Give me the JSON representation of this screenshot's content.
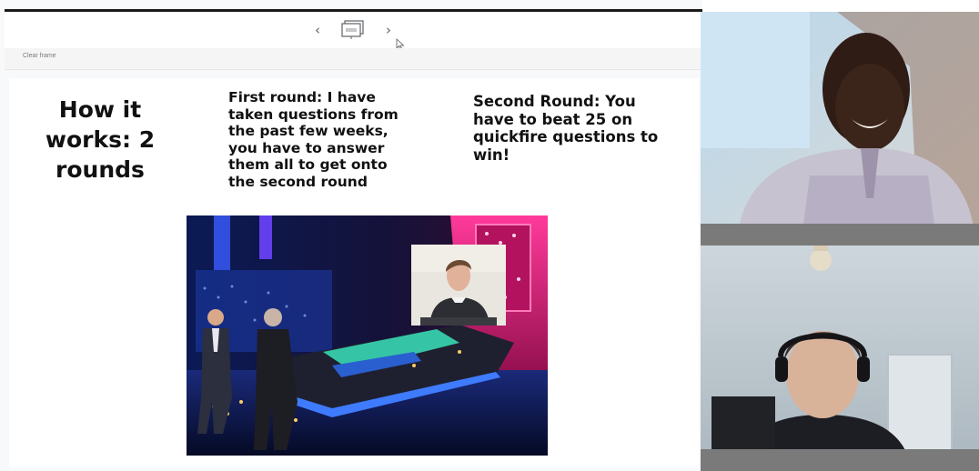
{
  "navigation": {
    "prev_label": "‹",
    "next_label": "›",
    "frame_icon": "frame-thumbnail-icon"
  },
  "toolbar": {
    "clear_frame_label": "Clear frame"
  },
  "slide": {
    "title": "How it works: 2 rounds",
    "first_round": "First round: I have taken questions from the past few weeks, you have to answer them all to get onto the second round",
    "second_round": "Second Round: You have to beat 25 on quickfire questions to win!"
  },
  "colors": {
    "slide_background": "#ffffff",
    "share_background": "#f8f9fa",
    "tile_bar": "#7a7a7a",
    "studio_teal": "#35c5a6",
    "studio_pink": "#d81b7c"
  },
  "participants": [
    {
      "id": "participant-1"
    },
    {
      "id": "participant-2"
    }
  ]
}
